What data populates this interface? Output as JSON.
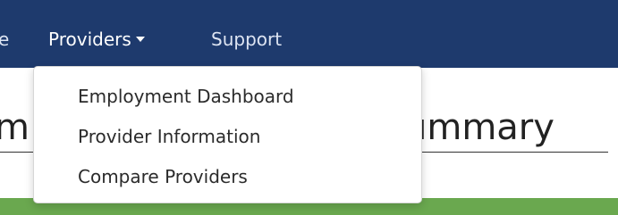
{
  "navbar": {
    "cut_item_label": "e",
    "providers_label": "Providers",
    "support_label": "Support"
  },
  "dropdown": {
    "items": [
      {
        "label": "Employment Dashboard"
      },
      {
        "label": "Provider Information"
      },
      {
        "label": "Compare Providers"
      }
    ]
  },
  "page": {
    "title_left_fragment": "m",
    "title_right_fragment": "ummary"
  },
  "colors": {
    "navbar": "#1e3a6d",
    "accent_bar": "#6aa84f",
    "dropdown_bg": "#ffffff"
  },
  "icons": {
    "providers_toggle": "caret-down-icon"
  }
}
